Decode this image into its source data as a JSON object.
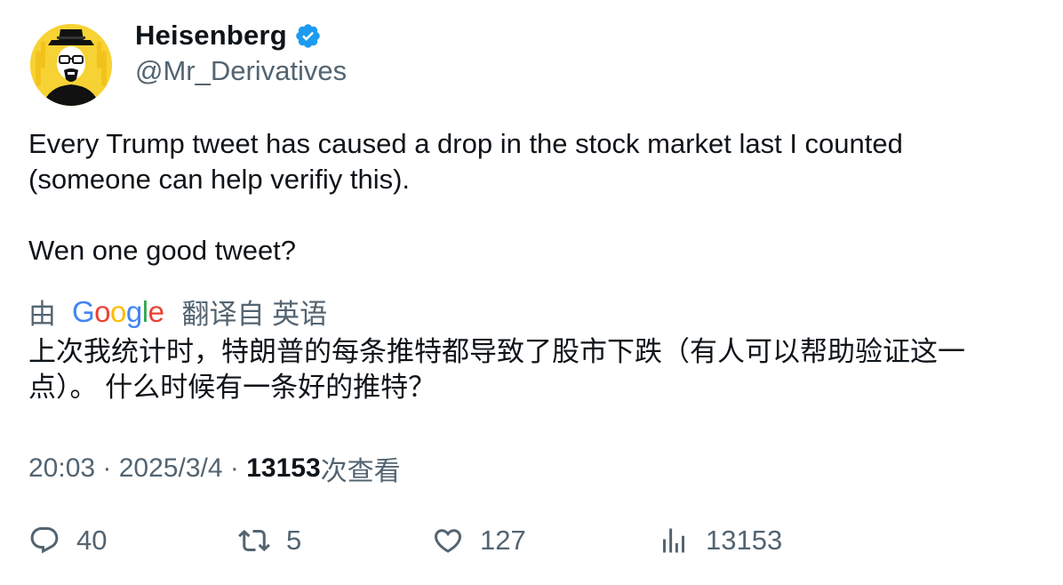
{
  "user": {
    "display_name": "Heisenberg",
    "handle": "@Mr_Derivatives",
    "verified": true
  },
  "tweet": {
    "text": "Every Trump tweet has caused a drop in the stock market last I counted (someone can help verifiy this).\n\nWen one good tweet?"
  },
  "translation": {
    "prefix": "由",
    "provider": "Google",
    "suffix": "翻译自 英语",
    "text": "上次我统计时，特朗普的每条推特都导致了股市下跌（有人可以帮助验证这一点）。 什么时候有一条好的推特？"
  },
  "meta": {
    "time": "20:03",
    "separator": " · ",
    "date": "2025/3/4",
    "views": "13153",
    "views_label": "次查看"
  },
  "actions": {
    "replies": "40",
    "reposts": "5",
    "likes": "127",
    "views": "13153"
  },
  "colors": {
    "text_primary": "#0f1419",
    "text_secondary": "#536471",
    "verified_blue": "#1d9bf0",
    "avatar_bg": "#f7d234",
    "google_blue": "#4285f4",
    "google_red": "#ea4335",
    "google_yellow": "#fbbc05",
    "google_green": "#34a853"
  },
  "icons": {
    "reply": "speech-bubble-icon",
    "repost": "retweet-arrows-icon",
    "like": "heart-icon",
    "views": "bar-chart-icon",
    "verified": "verified-badge-icon"
  }
}
